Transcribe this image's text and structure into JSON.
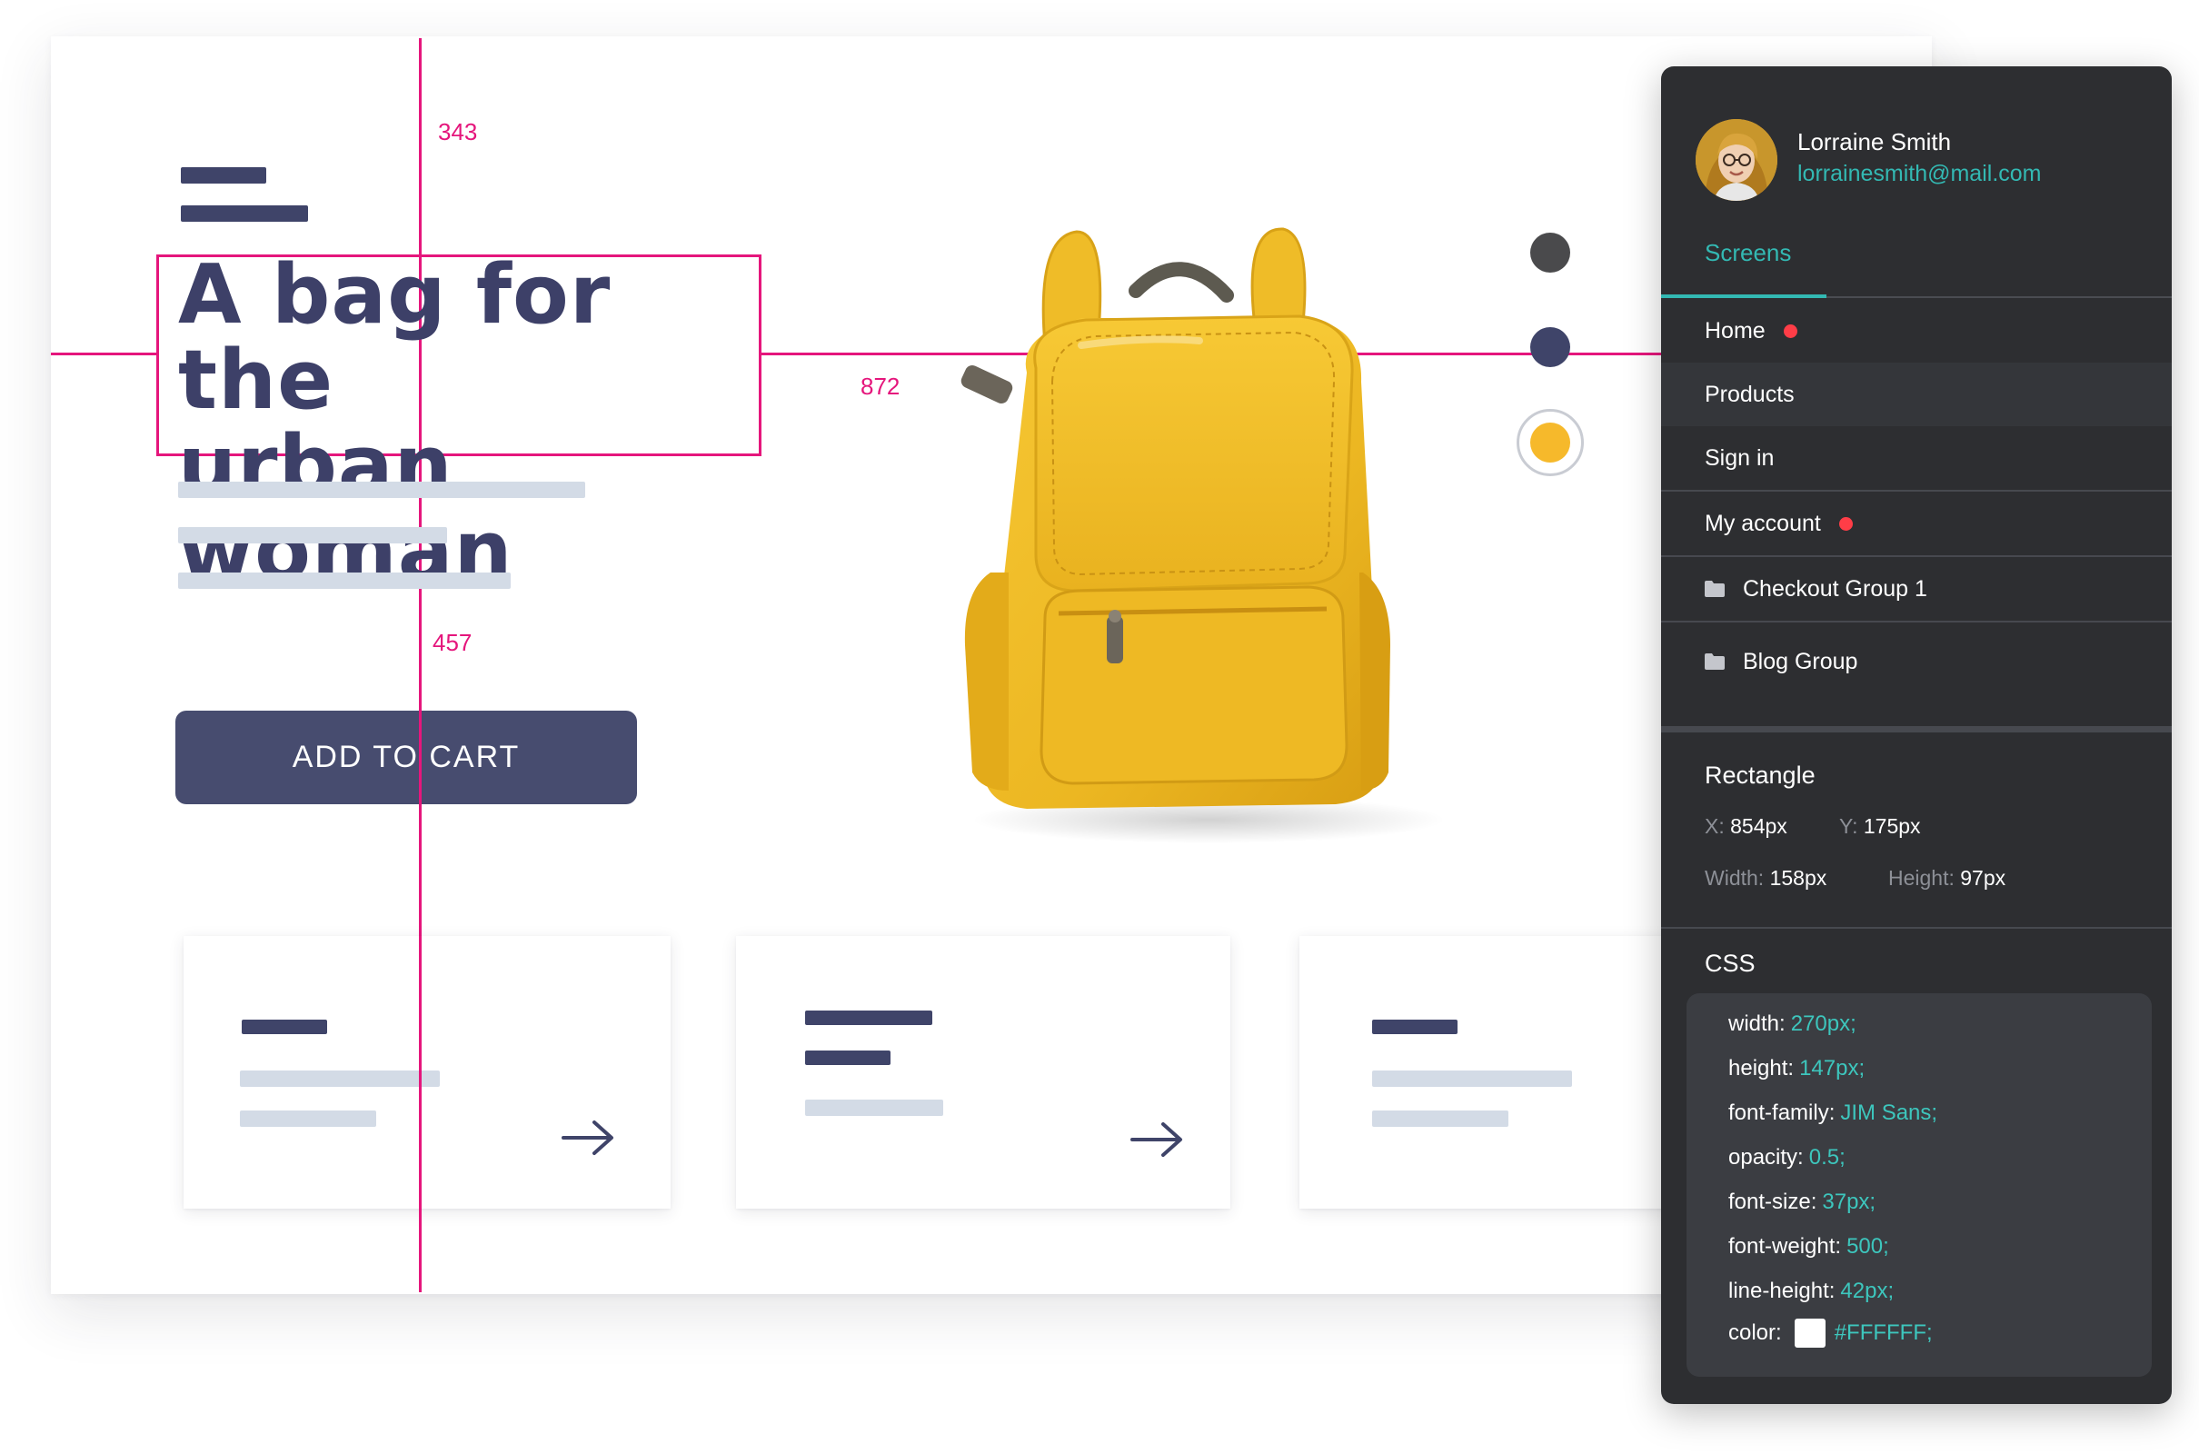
{
  "colors": {
    "accent_pink": "#e5167c",
    "navy": "#3d4068",
    "button": "#474c6f",
    "panel_bg": "#2d2e31",
    "teal": "#33b9b3",
    "red_dot": "#ff3d47",
    "bag_yellow": "#f2c12e"
  },
  "hero": {
    "title_line1": "A bag for the",
    "title_line2": "urban woman",
    "cta_label": "ADD TO CART"
  },
  "guides": {
    "label_top": "343",
    "label_right": "872",
    "label_bottom": "457"
  },
  "swatches": [
    "#4a4a4c",
    "#3f4469",
    "#f6b92b"
  ],
  "cards": [
    {
      "arrow_icon": "arrow-right-icon"
    },
    {
      "arrow_icon": "arrow-right-icon"
    },
    {
      "arrow_icon": "arrow-right-icon"
    }
  ],
  "panel": {
    "user": {
      "name": "Lorraine Smith",
      "email": "lorrainesmith@mail.com"
    },
    "tab": "Screens",
    "nav": [
      {
        "label": "Home",
        "dot": true
      },
      {
        "label": "Products",
        "dot": false,
        "active": true
      },
      {
        "label": "Sign in",
        "dot": false
      },
      {
        "label": "My account",
        "dot": true
      },
      {
        "label": "Checkout Group 1",
        "icon": "folder-icon"
      },
      {
        "label": "Blog Group",
        "icon": "folder-icon"
      }
    ],
    "selection": {
      "title": "Rectangle",
      "x_label": "X:",
      "x_value": "854px",
      "y_label": "Y:",
      "y_value": "175px",
      "w_label": "Width:",
      "w_value": "158px",
      "h_label": "Height:",
      "h_value": "97px"
    },
    "css": {
      "title": "CSS",
      "lines": [
        {
          "prop": "width:",
          "value": "270px;"
        },
        {
          "prop": "height:",
          "value": "147px;"
        },
        {
          "prop": "font-family:",
          "value": "JIM Sans;"
        },
        {
          "prop": "opacity:",
          "value": "0.5;"
        },
        {
          "prop": "font-size:",
          "value": "37px;"
        },
        {
          "prop": "font-weight:",
          "value": "500;"
        },
        {
          "prop": "line-height:",
          "value": "42px;"
        },
        {
          "prop": "color:",
          "value": "#FFFFFF;"
        }
      ]
    }
  }
}
